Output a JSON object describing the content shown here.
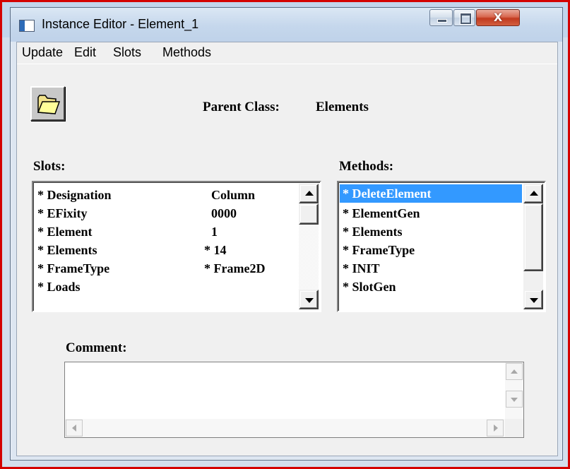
{
  "window": {
    "title": "Instance Editor - Element_1",
    "close_glyph": "X"
  },
  "menu": [
    "Update",
    "Edit",
    "Slots",
    "Methods"
  ],
  "parent_class": {
    "label": "Parent Class:",
    "value": "Elements"
  },
  "slots": {
    "label": "Slots:",
    "rows": [
      {
        "name": "* Designation",
        "value": "Column"
      },
      {
        "name": "* EFixity",
        "value": "0000"
      },
      {
        "name": "* Element",
        "value": "1"
      },
      {
        "name": "* Elements",
        "value": "* 14"
      },
      {
        "name": "* FrameType",
        "value": "* Frame2D"
      },
      {
        "name": "* Loads",
        "value": ""
      }
    ]
  },
  "methods": {
    "label": "Methods:",
    "selected": "* DeleteElement",
    "items": [
      "* DeleteElement",
      "* ElementGen",
      "* Elements",
      "* FrameType",
      "* INIT",
      "* SlotGen"
    ]
  },
  "comment": {
    "label": "Comment:",
    "value": ""
  },
  "icons": {
    "folder": "folder-icon",
    "app": "window-icon"
  },
  "colors": {
    "selection": "#3399ff",
    "frame": "#d40000"
  }
}
